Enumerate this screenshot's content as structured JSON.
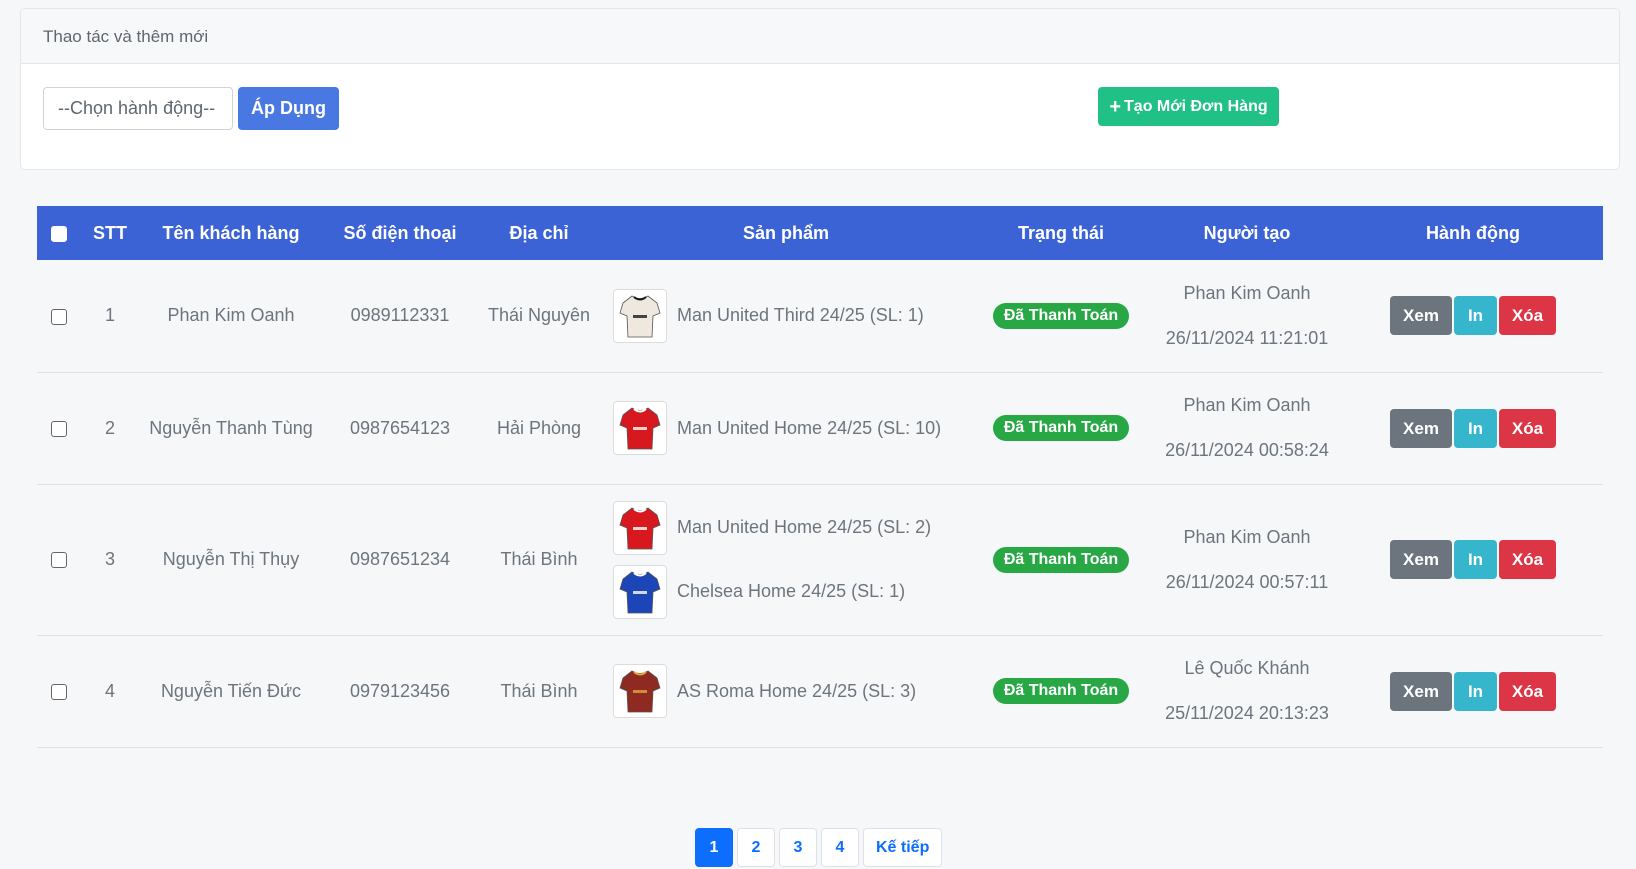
{
  "panel": {
    "title": "Thao tác và thêm mới",
    "select_placeholder": "--Chọn hành động--",
    "apply_label": "Áp Dụng",
    "create_label": "Tạo Mới Đơn Hàng"
  },
  "table": {
    "columns": [
      "STT",
      "Tên khách hàng",
      "Số điện thoại",
      "Địa chỉ",
      "Sản phẩm",
      "Trạng thái",
      "Người tạo",
      "Hành động"
    ],
    "rows": [
      {
        "stt": "1",
        "customer": "Phan Kim Oanh",
        "phone": "0989112331",
        "address": "Thái Nguyên",
        "products": [
          {
            "name": "Man United Third 24/25 (SL: 1)",
            "shirt_color": "#efe8de",
            "trim_color": "#1a1a1a"
          }
        ],
        "status": "Đã Thanh Toán",
        "creator": "Phan Kim Oanh",
        "created_at": "26/11/2024 11:21:01"
      },
      {
        "stt": "2",
        "customer": "Nguyễn Thanh Tùng",
        "phone": "0987654123",
        "address": "Hải Phòng",
        "products": [
          {
            "name": "Man United Home 24/25 (SL: 10)",
            "shirt_color": "#d7191f",
            "trim_color": "#ffffff"
          }
        ],
        "status": "Đã Thanh Toán",
        "creator": "Phan Kim Oanh",
        "created_at": "26/11/2024 00:58:24"
      },
      {
        "stt": "3",
        "customer": "Nguyễn Thị Thụy",
        "phone": "0987651234",
        "address": "Thái Bình",
        "products": [
          {
            "name": "Man United Home 24/25 (SL: 2)",
            "shirt_color": "#d7191f",
            "trim_color": "#ffffff"
          },
          {
            "name": "Chelsea Home 24/25 (SL: 1)",
            "shirt_color": "#1c46b8",
            "trim_color": "#ffffff"
          }
        ],
        "status": "Đã Thanh Toán",
        "creator": "Phan Kim Oanh",
        "created_at": "26/11/2024 00:57:11"
      },
      {
        "stt": "4",
        "customer": "Nguyễn Tiến Đức",
        "phone": "0979123456",
        "address": "Thái Bình",
        "products": [
          {
            "name": "AS Roma Home 24/25 (SL: 3)",
            "shirt_color": "#8e2a22",
            "trim_color": "#e8a33a"
          }
        ],
        "status": "Đã Thanh Toán",
        "creator": "Lê Quốc Khánh",
        "created_at": "25/11/2024 20:13:23"
      }
    ],
    "actions": {
      "view": "Xem",
      "print": "In",
      "delete": "Xóa"
    }
  },
  "pagination": {
    "pages": [
      "1",
      "2",
      "3",
      "4"
    ],
    "current": "1",
    "next_label": "Kế tiếp"
  },
  "colors": {
    "header_blue": "#3b63d6",
    "apply_blue": "#4a78e3",
    "create_green": "#21c087",
    "status_green": "#28a745",
    "view_gray": "#6c757d",
    "print_cyan": "#36b6cc",
    "delete_red": "#dc3545"
  }
}
